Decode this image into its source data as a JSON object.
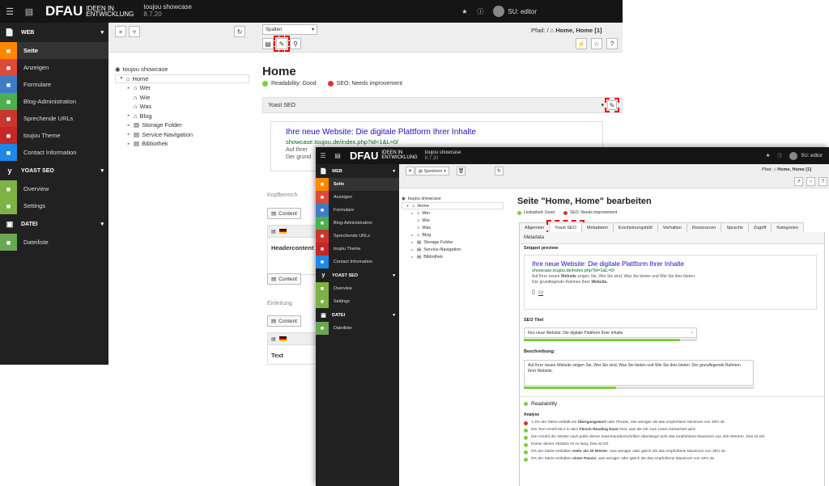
{
  "app": {
    "logo": "DFAU",
    "logo_sub_line1": "IDEEN IN",
    "logo_sub_line2": "ENTWICKLUNG",
    "site_name": "toujou showcase",
    "version": "8.7.20",
    "user": "SU: editor"
  },
  "sidebar": {
    "web_label": "WEB",
    "web_items": [
      {
        "label": "Seite",
        "icon": "page-icon",
        "color": "#ff8700"
      },
      {
        "label": "Anzeigen",
        "icon": "eye-icon",
        "color": "#dd4b39"
      },
      {
        "label": "Formulare",
        "icon": "form-icon",
        "color": "#3d7cc6"
      },
      {
        "label": "Blog-Administration",
        "icon": "blog-icon",
        "color": "#4caf50"
      },
      {
        "label": "Sprechende URLs",
        "icon": "pen-icon",
        "color": "#c8372d"
      },
      {
        "label": "toujou Theme",
        "icon": "fingerprint-icon",
        "color": "#c62828"
      },
      {
        "label": "Contact Information",
        "icon": "contact-icon",
        "color": "#1e88e5"
      }
    ],
    "yoast_label": "YOAST SEO",
    "yoast_items": [
      {
        "label": "Overview",
        "icon": "list-icon",
        "color": "#7cb342"
      },
      {
        "label": "Settings",
        "icon": "gear-icon",
        "color": "#7cb342"
      }
    ],
    "datei_label": "DATEI",
    "datei_items": [
      {
        "label": "Dateiliste",
        "icon": "filelist-icon",
        "color": "#6aa84f"
      }
    ]
  },
  "tree": {
    "root": "toujou showcase",
    "nodes": [
      "Home",
      "Wer",
      "Wie",
      "Was",
      "Blog",
      "Storage Folder",
      "Service-Navigation",
      "Bibliothek"
    ]
  },
  "window1": {
    "view_select": "Spalten",
    "path_label": "Pfad: /",
    "path_value": "Home, Home [1]",
    "page_title": "Home",
    "readability": "Readability: Good",
    "seo": "SEO: Needs improvement",
    "yoast_header": "Yoast SEO",
    "snippet_title": "Ihre neue Website: Die digitale Plattform Ihrer Inhalte",
    "snippet_url": "showcase.toujou.de/index.php?id=1&L=0/",
    "snippet_desc1": "Auf Ihrer",
    "snippet_desc2": "Der grund",
    "col1_label": "Kopfbereich",
    "content_button": "Content",
    "ce1_title": "Headercontent",
    "col2_label": "Einleitung",
    "ce2_title": "Text"
  },
  "window2": {
    "save_label": "Speichern",
    "path_label": "Pfad:",
    "path_value": "Home, Home [1]",
    "edit_title": "Seite \"Home, Home\" bearbeiten",
    "readability": "Lesbarkeit: Good",
    "seo": "SEO: Needs improvement",
    "tabs": [
      "Allgemein",
      "Yoast SEO",
      "Metadaten",
      "Erscheinungsbild",
      "Verhalten",
      "Ressourcen",
      "Sprache",
      "Zugriff",
      "Kategorien"
    ],
    "section_title": "Metadata",
    "snippet_preview_label": "Snippet preview",
    "snippet_title": "Ihre neue Website: Die digitale Plattform Ihrer Inhalte",
    "snippet_url": "showcase.toujou.de/index.php?id=1&L=0/",
    "snippet_desc_a": "Auf Ihrer neuen ",
    "snippet_desc_b": "Website",
    "snippet_desc_c": " zeigen Sie, Wer Sie sind, Was Sie bieten und Wie Sie dies bieten.",
    "snippet_desc2_a": "Der grundlegende Rahmen Ihrer ",
    "snippet_desc2_b": "Website.",
    "seo_title_label": "SEO Titel",
    "seo_title_value": "Ihre neue Website: Die digitale Plattform Ihrer Inhalte",
    "seo_title_progress": 0.9,
    "desc_label": "Beschreibung:",
    "desc_value": "Auf Ihrer neuen Website zeigen Sie, Wer Sie sind, Was Sie bieten und Wie Sie dies bieten. Der grundlegende Rahmen Ihrer Website.",
    "desc_progress": 0.4,
    "readability_heading": "Readability",
    "analysis_label": "Analyse",
    "analysis": [
      {
        "status": "red",
        "a": "1.3% der Sätze enthält ein ",
        "b": "Übergangswort",
        "c": " oder Phrase, das weniger als das empfohlene Minimum von 30% ist."
      },
      {
        "status": "green",
        "a": "Der Text erzielt 66.2 in dem ",
        "b": "Flesch Reading Ease",
        "c": "-Test, was als OK zum Lesen betrachtet wird."
      },
      {
        "status": "green",
        "a": "Die Anzahl der Wörter nach jeder deiner Zwischenüberschriften übersteigt nicht das empfohlene Maximum von 300 Wörtern. Das ist toll.",
        "b": "",
        "c": ""
      },
      {
        "status": "green",
        "a": "Keiner deiner Absätze ist zu lang. Das ist toll.",
        "b": "",
        "c": ""
      },
      {
        "status": "green",
        "a": "0% der Sätze enthalten ",
        "b": "mehr als 20 Wörter",
        "c": ", was weniger oder gleich als das empfohlene Maximum von 25% ist."
      },
      {
        "status": "green",
        "a": "0% der Sätze enthalten ",
        "b": "einen Passiv",
        "c": ", was weniger oder gleich als das empfohlene Maximum von 10% ist."
      }
    ]
  }
}
